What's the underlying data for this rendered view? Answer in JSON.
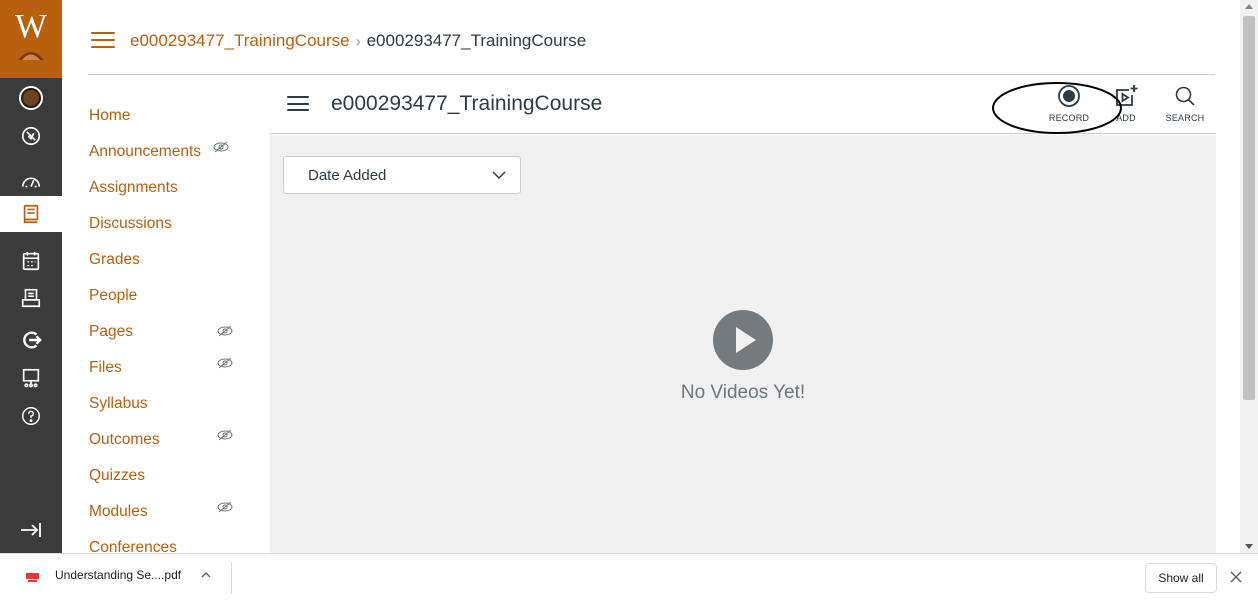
{
  "breadcrumb": {
    "course_link": "e000293477_TrainingCourse",
    "separator": "›",
    "current": "e000293477_TrainingCourse"
  },
  "logo": {
    "letter": "W"
  },
  "course_nav": {
    "items": [
      {
        "label": "Home",
        "hidden": false
      },
      {
        "label": "Announcements",
        "hidden": true
      },
      {
        "label": "Assignments",
        "hidden": false
      },
      {
        "label": "Discussions",
        "hidden": false
      },
      {
        "label": "Grades",
        "hidden": false
      },
      {
        "label": "People",
        "hidden": false
      },
      {
        "label": "Pages",
        "hidden": true
      },
      {
        "label": "Files",
        "hidden": true
      },
      {
        "label": "Syllabus",
        "hidden": false
      },
      {
        "label": "Outcomes",
        "hidden": true
      },
      {
        "label": "Quizzes",
        "hidden": false
      },
      {
        "label": "Modules",
        "hidden": true
      },
      {
        "label": "Conferences",
        "hidden": false
      }
    ]
  },
  "content": {
    "title": "e000293477_TrainingCourse",
    "toolbar": {
      "record_label": "RECORD",
      "add_label": "ADD",
      "search_label": "SEARCH"
    },
    "sort": {
      "selected": "Date Added"
    },
    "empty_text": "No Videos Yet!"
  },
  "downloads": {
    "file_name": "Understanding Se....pdf",
    "show_all_label": "Show all"
  },
  "colors": {
    "accent": "#b8600e",
    "nav_bg": "#3b3b3b",
    "content_bg": "#f0f0f0",
    "text": "#2d3b45"
  }
}
